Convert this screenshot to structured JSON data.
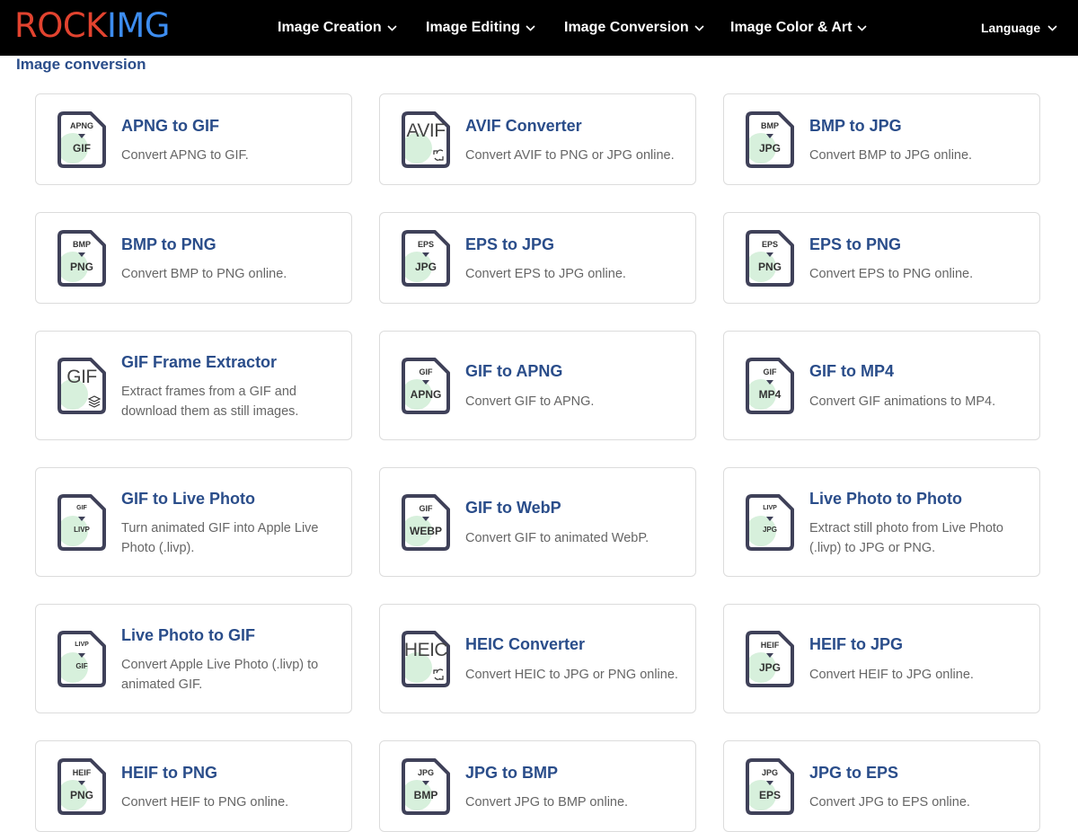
{
  "header": {
    "logo_part1": "ROCK",
    "logo_part2": "IMG",
    "nav": [
      {
        "label": "Image Creation"
      },
      {
        "label": "Image Editing"
      },
      {
        "label": "Image Conversion"
      },
      {
        "label": "Image Color & Art"
      }
    ],
    "language_label": "Language"
  },
  "section": {
    "title": "Image conversion"
  },
  "tools": [
    {
      "title": "APNG to GIF",
      "desc": "Convert APNG to GIF.",
      "icon_top": "APNG",
      "icon_bottom": "GIF"
    },
    {
      "title": "AVIF Converter",
      "desc": "Convert AVIF to PNG or JPG online.",
      "icon_main": "AVIF"
    },
    {
      "title": "BMP to JPG",
      "desc": "Convert BMP to JPG online.",
      "icon_top": "BMP",
      "icon_bottom": "JPG"
    },
    {
      "title": "BMP to PNG",
      "desc": "Convert BMP to PNG online.",
      "icon_top": "BMP",
      "icon_bottom": "PNG"
    },
    {
      "title": "EPS to JPG",
      "desc": "Convert EPS to JPG online.",
      "icon_top": "EPS",
      "icon_bottom": "JPG"
    },
    {
      "title": "EPS to PNG",
      "desc": "Convert EPS to PNG online.",
      "icon_top": "EPS",
      "icon_bottom": "PNG"
    },
    {
      "title": "GIF Frame Extractor",
      "desc": "Extract frames from a GIF and download them as still images.",
      "icon_main": "GIF"
    },
    {
      "title": "GIF to APNG",
      "desc": "Convert GIF to APNG.",
      "icon_top": "GIF",
      "icon_bottom": "APNG"
    },
    {
      "title": "GIF to MP4",
      "desc": "Convert GIF animations to MP4.",
      "icon_top": "GIF",
      "icon_bottom": "MP4"
    },
    {
      "title": "GIF to Live Photo",
      "desc": "Turn animated GIF into Apple Live Photo (.livp).",
      "icon_top": "GIF",
      "icon_bottom": "LIVP"
    },
    {
      "title": "GIF to WebP",
      "desc": "Convert GIF to animated WebP.",
      "icon_top": "GIF",
      "icon_bottom": "WEBP"
    },
    {
      "title": "Live Photo to Photo",
      "desc": "Extract still photo from Live Photo (.livp) to JPG or PNG.",
      "icon_top": "LIVP",
      "icon_bottom": "JPG"
    },
    {
      "title": "Live Photo to GIF",
      "desc": "Convert Apple Live Photo (.livp) to animated GIF.",
      "icon_top": "LIVP",
      "icon_bottom": "GIF"
    },
    {
      "title": "HEIC Converter",
      "desc": "Convert HEIC to JPG or PNG online.",
      "icon_main": "HEIC"
    },
    {
      "title": "HEIF to JPG",
      "desc": "Convert HEIF to JPG online.",
      "icon_top": "HEIF",
      "icon_bottom": "JPG"
    },
    {
      "title": "HEIF to PNG",
      "desc": "Convert HEIF to PNG online.",
      "icon_top": "HEIF",
      "icon_bottom": "PNG"
    },
    {
      "title": "JPG to BMP",
      "desc": "Convert JPG to BMP online.",
      "icon_top": "JPG",
      "icon_bottom": "BMP"
    },
    {
      "title": "JPG to EPS",
      "desc": "Convert JPG to EPS online.",
      "icon_top": "JPG",
      "icon_bottom": "EPS"
    }
  ]
}
